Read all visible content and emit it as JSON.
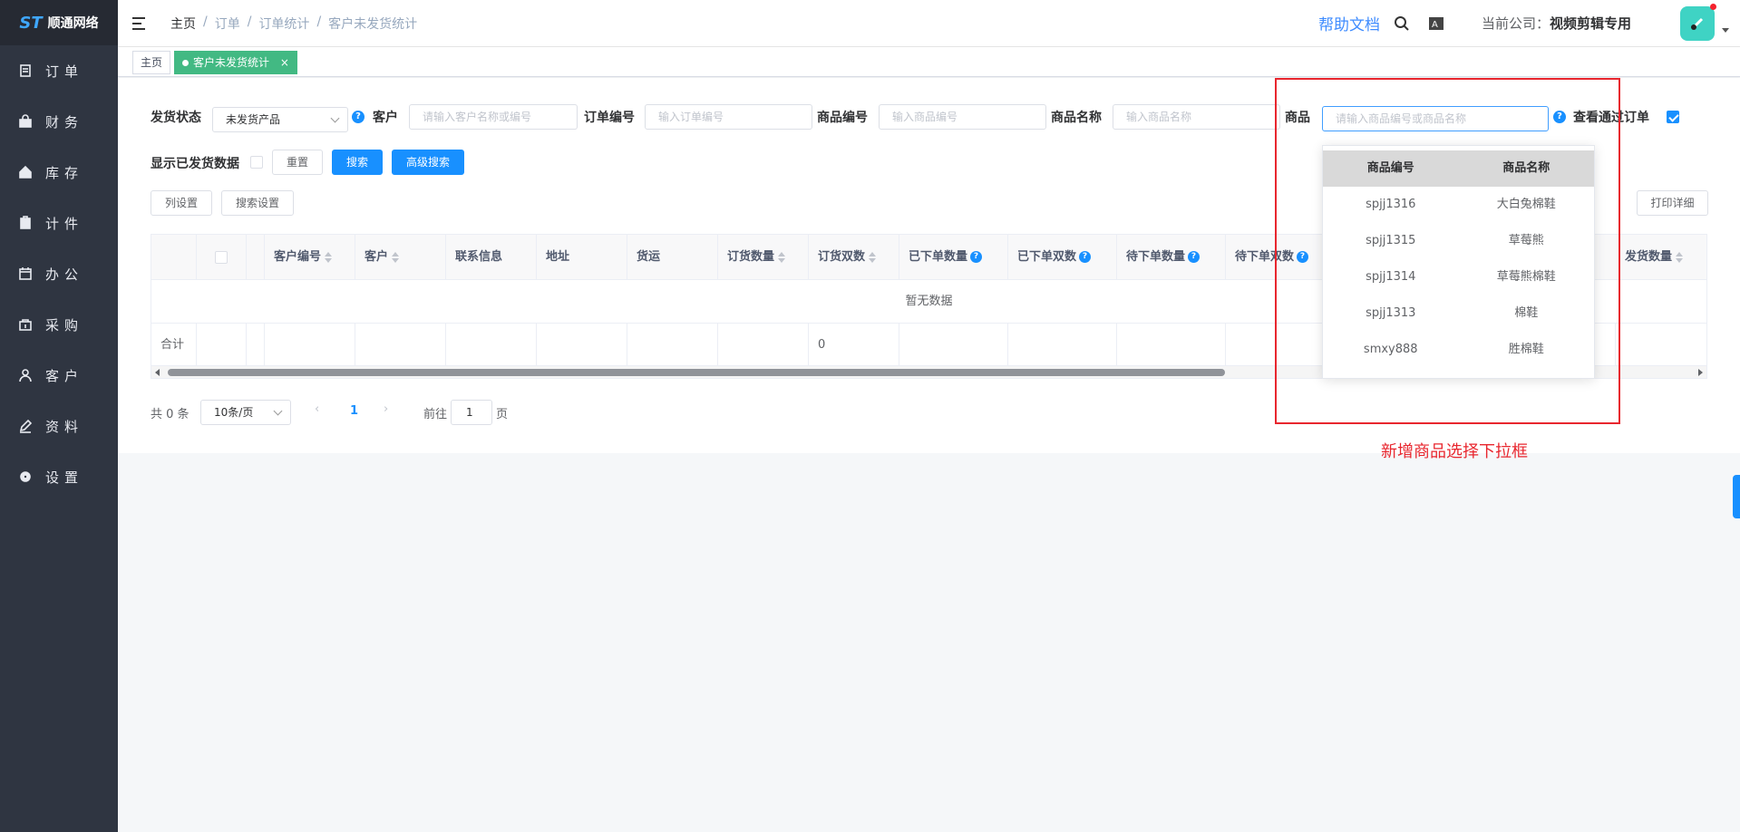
{
  "brand": {
    "name": "顺通网络",
    "mark": "ST"
  },
  "sidebar": {
    "items": [
      {
        "label": "订单",
        "icon": "order-icon"
      },
      {
        "label": "财务",
        "icon": "finance-icon"
      },
      {
        "label": "库存",
        "icon": "home-icon"
      },
      {
        "label": "计件",
        "icon": "clipboard-icon"
      },
      {
        "label": "办公",
        "icon": "calendar-icon"
      },
      {
        "label": "采购",
        "icon": "purchase-icon"
      },
      {
        "label": "客户",
        "icon": "user-icon"
      },
      {
        "label": "资料",
        "icon": "edit-icon"
      },
      {
        "label": "设置",
        "icon": "gear-icon"
      }
    ]
  },
  "header": {
    "breadcrumb": [
      "主页",
      "订单",
      "订单统计",
      "客户未发货统计"
    ],
    "help": "帮助文档",
    "company_label": "当前公司：",
    "company_name": "视频剪辑专用"
  },
  "tags": {
    "home": "主页",
    "current": "客户未发货统计",
    "close": "×"
  },
  "filters": {
    "ship_status_label": "发货状态",
    "ship_status_value": "未发货产品",
    "customer_label": "客户",
    "customer_placeholder": "请输入客户名称或编号",
    "order_no_label": "订单编号",
    "order_no_placeholder": "输入订单编号",
    "product_code_label": "商品编号",
    "product_code_placeholder": "输入商品编号",
    "product_name_label": "商品名称",
    "product_name_placeholder": "输入商品名称",
    "product_label": "商品",
    "product_placeholder": "请输入商品编号或商品名称",
    "view_approved_label": "查看通过订单",
    "show_shipped_label": "显示已发货数据",
    "qm": "?"
  },
  "buttons": {
    "reset": "重置",
    "search": "搜索",
    "advanced": "高级搜索",
    "columns": "列设置",
    "search_settings": "搜索设置",
    "print": "打印",
    "print_detail": "打印详细"
  },
  "table": {
    "headers": [
      "客户编号",
      "客户",
      "联系信息",
      "地址",
      "货运",
      "订货数量",
      "订货双数",
      "已下单数量",
      "已下单双数",
      "待下单数量",
      "待下单双数",
      "发货数量"
    ],
    "empty": "暂无数据",
    "sum_label": "合计",
    "sum_value": "0"
  },
  "pagination": {
    "total": "共 0 条",
    "page_size": "10条/页",
    "current": "1",
    "goto_label": "前往",
    "goto_value": "1",
    "page_unit": "页"
  },
  "dropdown": {
    "headers": [
      "商品编号",
      "商品名称"
    ],
    "rows": [
      [
        "spjj1316",
        "大白兔棉鞋"
      ],
      [
        "spjj1315",
        "草莓熊"
      ],
      [
        "spjj1314",
        "草莓熊棉鞋"
      ],
      [
        "spjj1313",
        "棉鞋"
      ],
      [
        "smxy888",
        "胜棉鞋"
      ]
    ]
  },
  "annotation": "新增商品选择下拉框"
}
